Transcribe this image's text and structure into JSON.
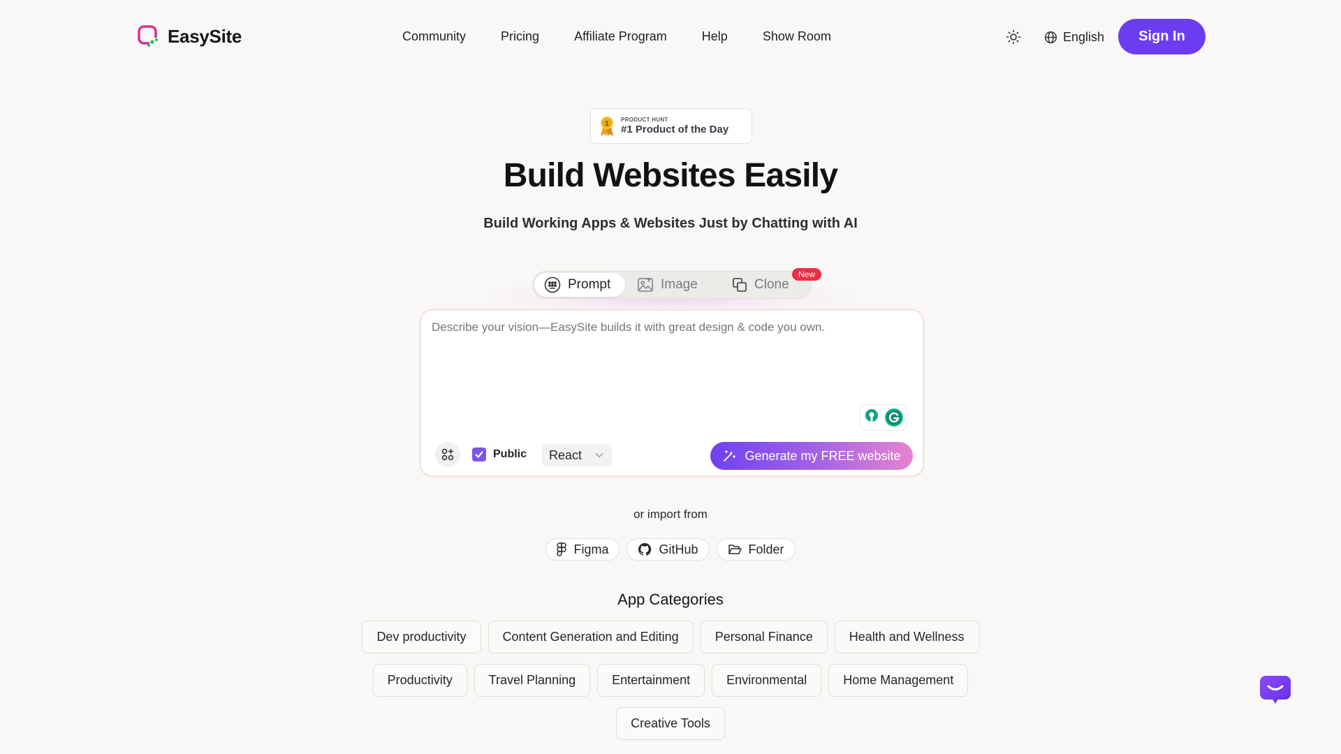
{
  "brand": {
    "name": "EasySite"
  },
  "nav": {
    "items": [
      "Community",
      "Pricing",
      "Affiliate Program",
      "Help",
      "Show Room"
    ]
  },
  "header": {
    "theme_icon": "sun-icon",
    "language": "English",
    "signin_label": "Sign In"
  },
  "badge": {
    "small": "PRODUCT HUNT",
    "big": "#1 Product of the Day"
  },
  "hero": {
    "title": "Build Websites Easily",
    "subtitle": "Build Working Apps & Websites Just by Chatting with AI"
  },
  "modes": {
    "tabs": [
      {
        "label": "Prompt",
        "icon": "prompt-icon",
        "active": true
      },
      {
        "label": "Image",
        "icon": "image-icon",
        "active": false
      },
      {
        "label": "Clone",
        "icon": "clone-icon",
        "active": false
      }
    ],
    "new_badge": "New"
  },
  "prompt": {
    "placeholder": "Describe your vision—EasySite builds it with great design & code you own.",
    "public_label": "Public",
    "public_checked": true,
    "framework": "React",
    "generate_label": "Generate my FREE website"
  },
  "imports": {
    "label": "or import from",
    "sources": [
      "Figma",
      "GitHub",
      "Folder"
    ]
  },
  "categories": {
    "title": "App Categories",
    "row1": [
      "Dev productivity",
      "Content Generation and Editing",
      "Personal Finance",
      "Health and Wellness"
    ],
    "row2": [
      "Productivity",
      "Travel Planning",
      "Entertainment",
      "Environmental",
      "Home Management"
    ],
    "row3": [
      "Creative Tools"
    ]
  },
  "colors": {
    "accent": "#6c3df0",
    "new_badge": "#ee2d45",
    "background": "#f9f8f6"
  }
}
